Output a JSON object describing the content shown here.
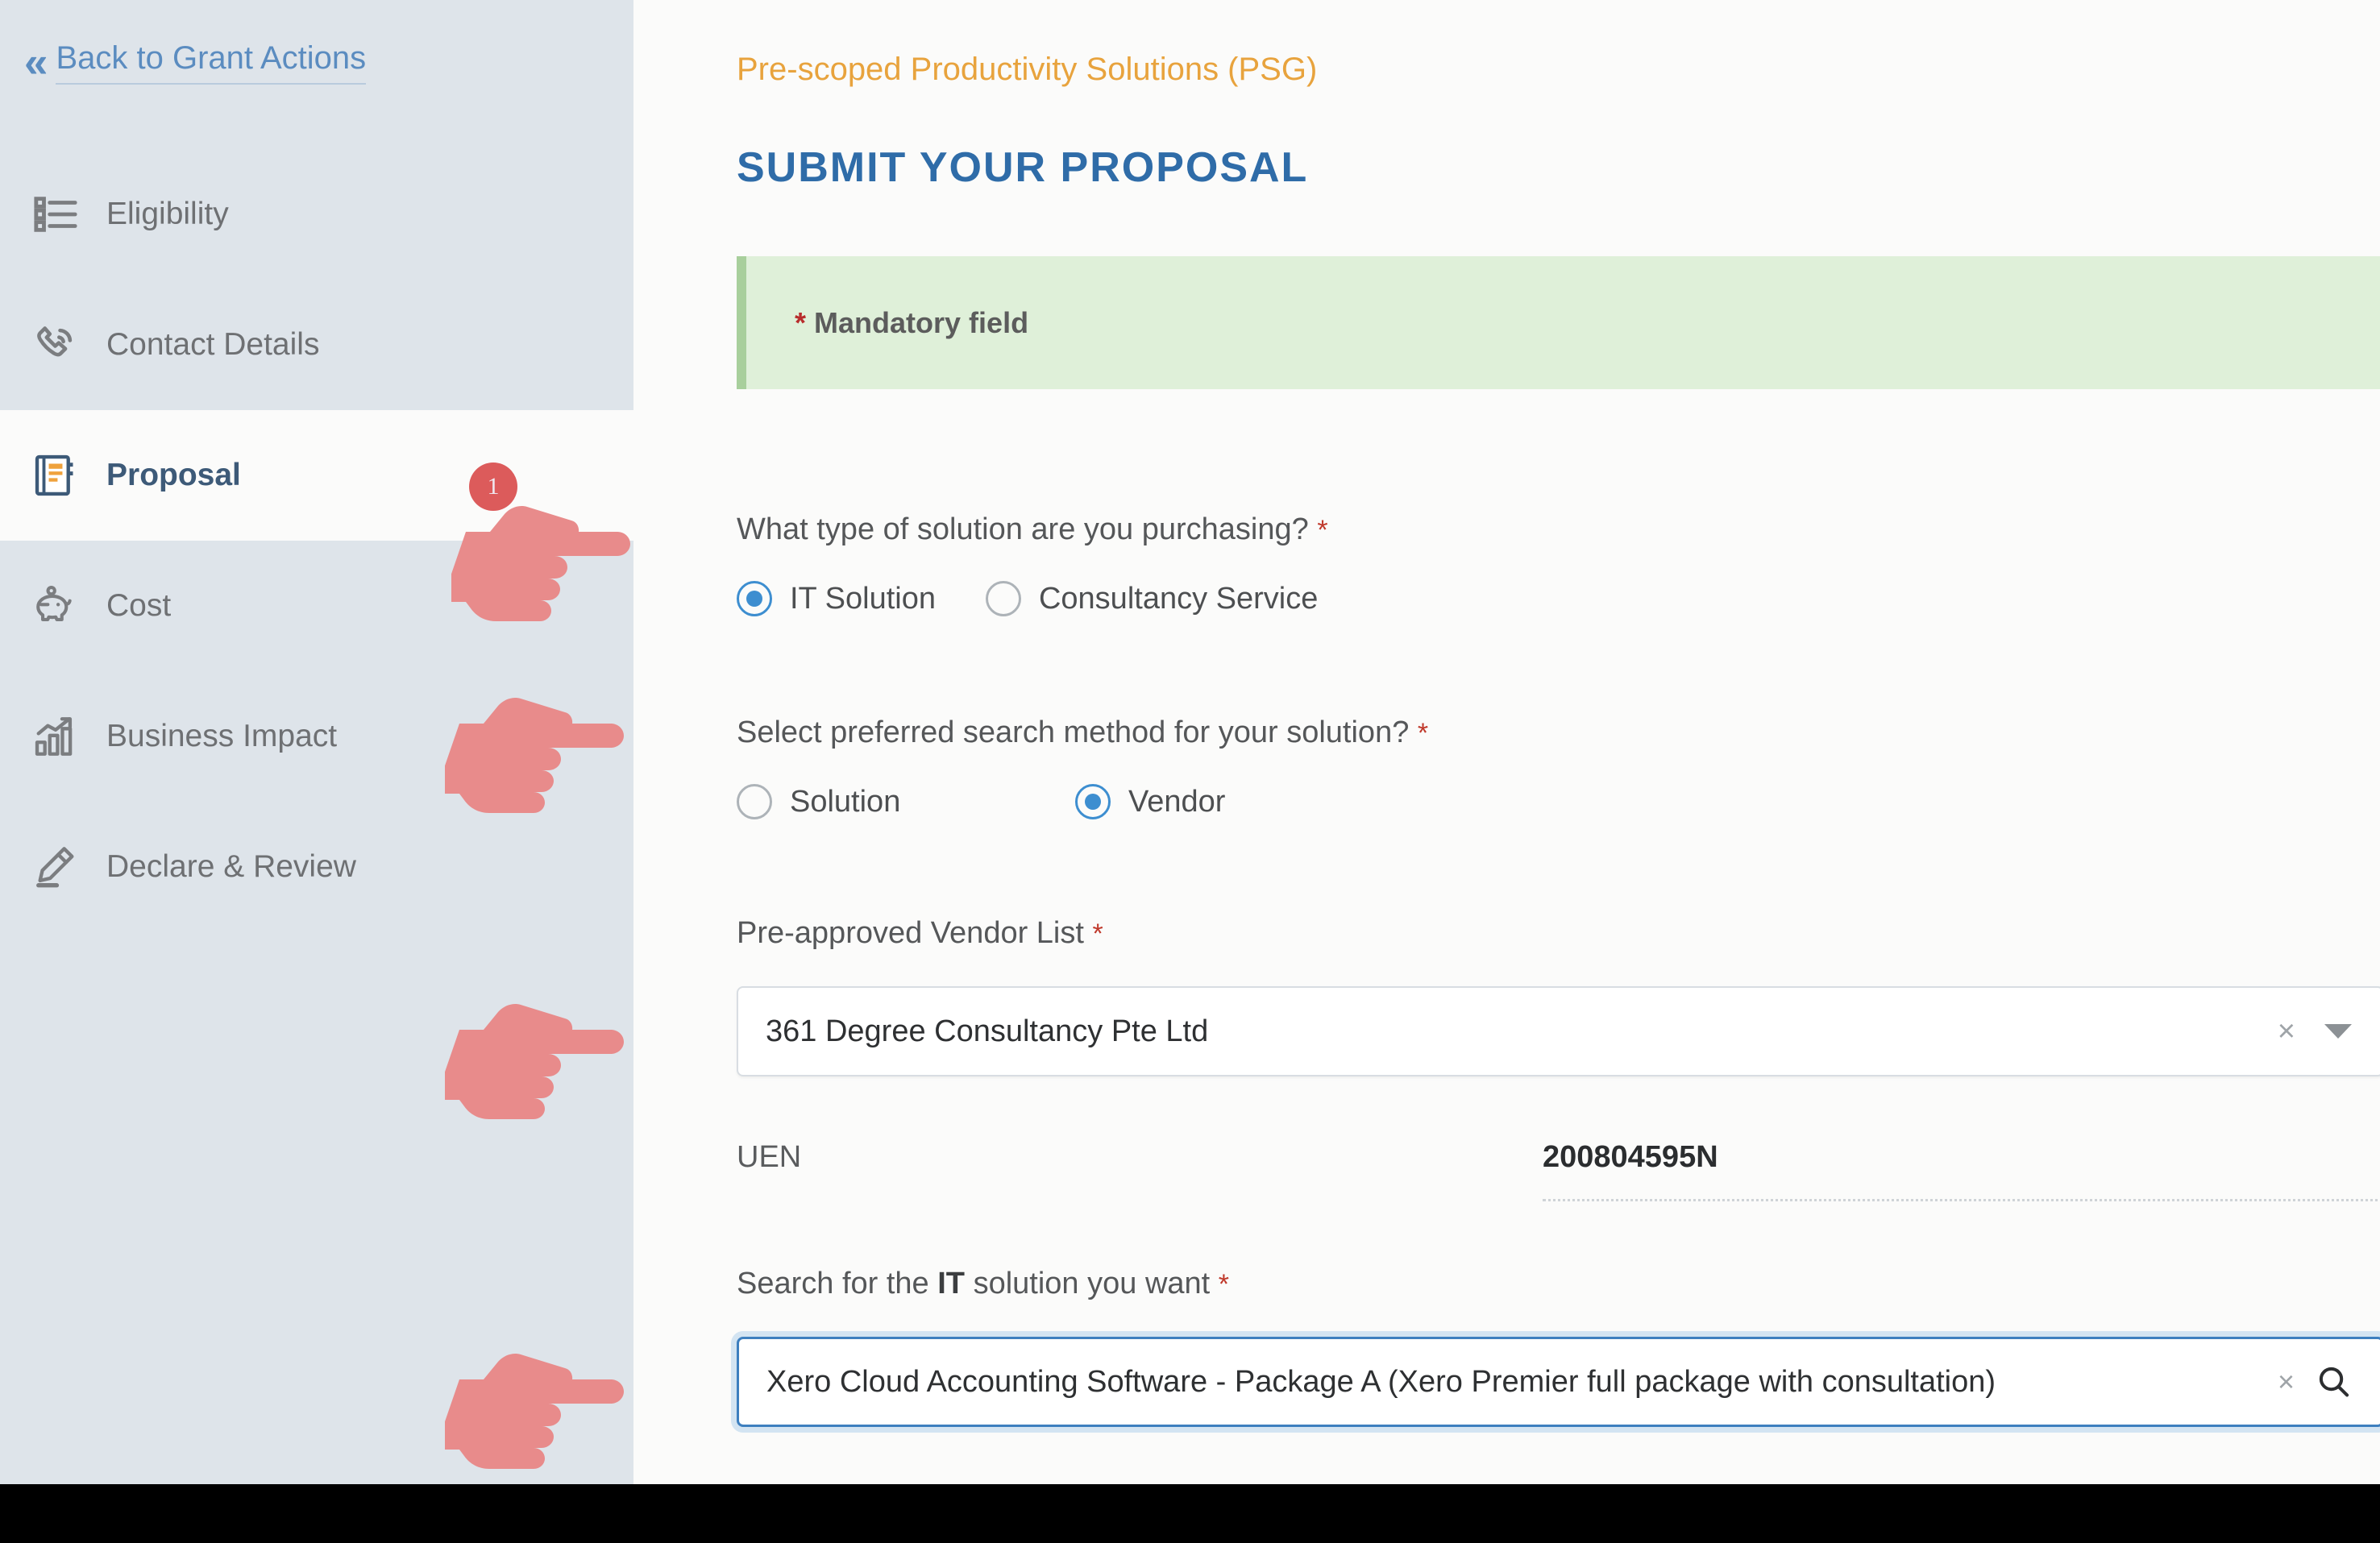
{
  "sidebar": {
    "back_link": {
      "label": "Back to Grant Actions",
      "chevron": "«"
    },
    "items": [
      {
        "label": "Eligibility",
        "icon": "list-icon",
        "active": false
      },
      {
        "label": "Contact Details",
        "icon": "phone-ring-icon",
        "active": false
      },
      {
        "label": "Proposal",
        "icon": "notebook-icon",
        "active": true
      },
      {
        "label": "Cost",
        "icon": "piggy-bank-icon",
        "active": false
      },
      {
        "label": "Business Impact",
        "icon": "bar-chart-arrow-icon",
        "active": false
      },
      {
        "label": "Declare & Review",
        "icon": "pen-sign-icon",
        "active": false
      }
    ]
  },
  "main": {
    "eyebrow": "Pre-scoped Productivity Solutions (PSG)",
    "title": "SUBMIT YOUR PROPOSAL",
    "banner": {
      "asterisk": "*",
      "text": "Mandatory field"
    },
    "question_solution_type": {
      "label": "What type of solution are you purchasing?",
      "required_mark": "*",
      "options": [
        {
          "label": "IT Solution",
          "selected": true
        },
        {
          "label": "Consultancy Service",
          "selected": false
        }
      ]
    },
    "question_search_method": {
      "label": "Select preferred search method for your solution?",
      "required_mark": "*",
      "options": [
        {
          "label": "Solution",
          "selected": false
        },
        {
          "label": "Vendor",
          "selected": true
        }
      ]
    },
    "vendor_list": {
      "label": "Pre-approved Vendor List",
      "required_mark": "*",
      "value": "361 Degree Consultancy Pte Ltd",
      "clear_glyph": "×"
    },
    "uen": {
      "label": "UEN",
      "value": "200804595N"
    },
    "solution_search": {
      "label_prefix": "Search for the ",
      "label_bold": "IT",
      "label_suffix": " solution you want",
      "required_mark": "*",
      "value": "Xero Cloud Accounting Software - Package A (Xero Premier full package with consultation)",
      "clear_glyph": "×"
    }
  },
  "annotations": {
    "hands": [
      {
        "badge": "1",
        "target": "solution-type-question"
      },
      {
        "badge": "",
        "target": "search-method-question"
      },
      {
        "badge": "",
        "target": "vendor-list-field"
      },
      {
        "badge": "",
        "target": "solution-search-field"
      }
    ]
  },
  "colors": {
    "sidebar_bg": "#dee4ea",
    "accent_orange": "#e8a33d",
    "title_blue": "#2f6ca8",
    "link_blue": "#5b8cc0",
    "banner_green": "#dff0d9",
    "banner_border": "#a8cf9c",
    "required_red": "#c0392b",
    "radio_blue": "#3d8ed0",
    "hand_pink": "#e88b8b",
    "badge_red": "#dc5b5b"
  }
}
